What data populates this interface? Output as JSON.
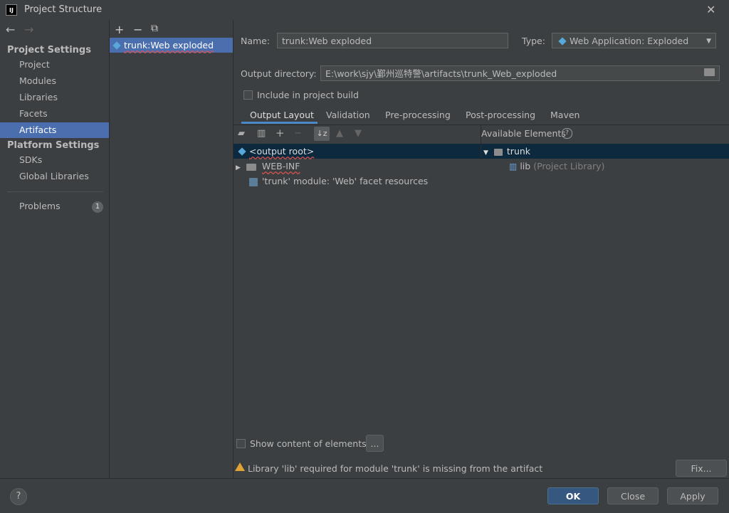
{
  "window": {
    "title": "Project Structure",
    "logo_text": "IJ"
  },
  "nav": {
    "back": "←",
    "forward": "→",
    "project_settings_title": "Project Settings",
    "project_settings": [
      "Project",
      "Modules",
      "Libraries",
      "Facets",
      "Artifacts"
    ],
    "platform_settings_title": "Platform Settings",
    "platform_settings": [
      "SDKs",
      "Global Libraries"
    ],
    "problems_label": "Problems",
    "problems_count": "1"
  },
  "artifacts": {
    "toolbar": {
      "add": "+",
      "remove": "−",
      "copy": "⧉"
    },
    "items": [
      "trunk:Web exploded"
    ]
  },
  "form": {
    "name_label": "Name:",
    "name_value": "trunk:Web exploded",
    "type_label": "Type:",
    "type_value": "Web Application: Exploded",
    "output_dir_label": "Output directory:",
    "output_dir_value": "E:\\work\\sjy\\鄞州巡特警\\artifacts\\trunk_Web_exploded",
    "include_build_label": "Include in project build"
  },
  "tabs": [
    "Output Layout",
    "Validation",
    "Pre-processing",
    "Post-processing",
    "Maven"
  ],
  "layout": {
    "available_elements_label": "Available Elements",
    "output_tree": [
      "<output root>",
      "WEB-INF",
      "'trunk' module: 'Web' facet resources"
    ],
    "available_tree": {
      "root": "trunk",
      "lib_name": "lib",
      "lib_suffix": "(Project Library)"
    }
  },
  "footer": {
    "show_content_label": "Show content of elements",
    "more_button": "...",
    "warning_text": "Library 'lib' required for module 'trunk' is missing from the artifact",
    "fix_button": "Fix..."
  },
  "buttons": {
    "help": "?",
    "ok": "OK",
    "close": "Close",
    "apply": "Apply"
  },
  "colors": {
    "accent": "#4b6eaf",
    "background": "#3c3f41",
    "selection_dark": "#0d293e",
    "warning": "#e0a335"
  }
}
